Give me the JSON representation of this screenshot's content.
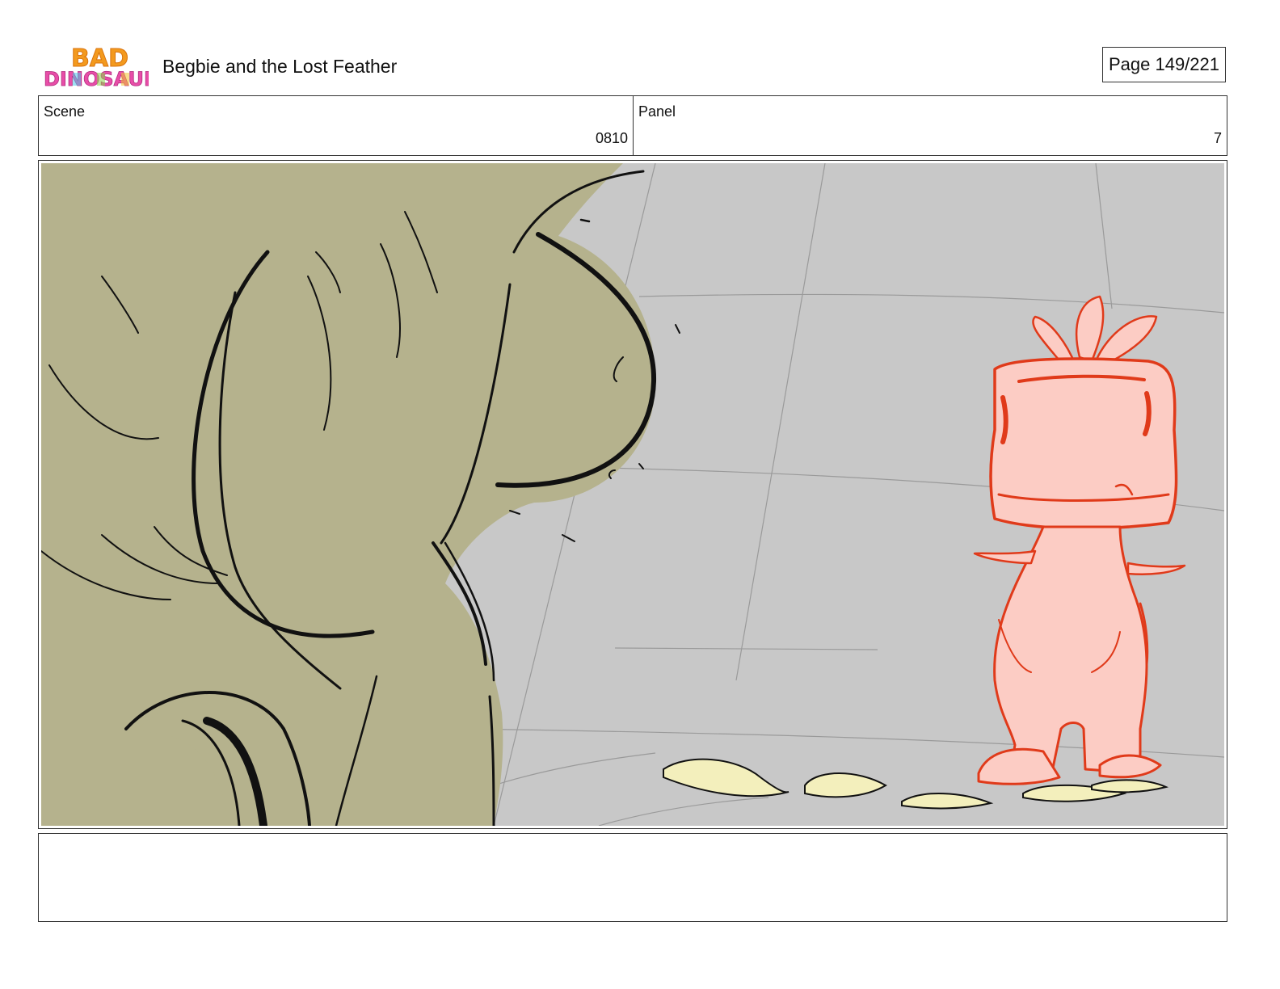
{
  "header": {
    "logo_text": "BAD DINOSAURS",
    "title": "Begbie and the Lost Feather",
    "page_counter": "Page 149/221"
  },
  "scene": {
    "label": "Scene",
    "value": "0810"
  },
  "panel": {
    "label": "Panel",
    "value": "7"
  },
  "notes": {
    "text": ""
  },
  "colors": {
    "background_floor": "#c8c8c8",
    "large_dino_fill": "#b5b28d",
    "pink_dino_fill": "#fcccc4",
    "pink_dino_outline": "#e03a1a",
    "feather_fill": "#f3efbc"
  }
}
